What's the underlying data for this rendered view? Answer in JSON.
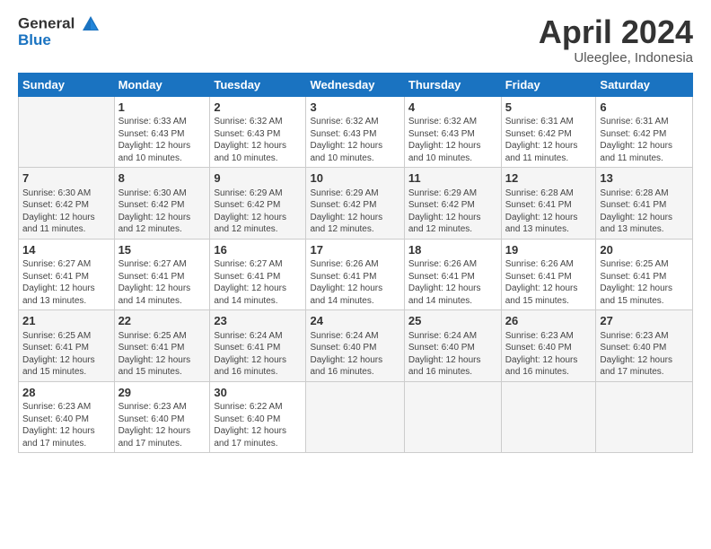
{
  "header": {
    "logo_line1": "General",
    "logo_line2": "Blue",
    "month": "April 2024",
    "location": "Uleeglee, Indonesia"
  },
  "days_of_week": [
    "Sunday",
    "Monday",
    "Tuesday",
    "Wednesday",
    "Thursday",
    "Friday",
    "Saturday"
  ],
  "weeks": [
    [
      {
        "day": "",
        "info": ""
      },
      {
        "day": "1",
        "info": "Sunrise: 6:33 AM\nSunset: 6:43 PM\nDaylight: 12 hours\nand 10 minutes."
      },
      {
        "day": "2",
        "info": "Sunrise: 6:32 AM\nSunset: 6:43 PM\nDaylight: 12 hours\nand 10 minutes."
      },
      {
        "day": "3",
        "info": "Sunrise: 6:32 AM\nSunset: 6:43 PM\nDaylight: 12 hours\nand 10 minutes."
      },
      {
        "day": "4",
        "info": "Sunrise: 6:32 AM\nSunset: 6:43 PM\nDaylight: 12 hours\nand 10 minutes."
      },
      {
        "day": "5",
        "info": "Sunrise: 6:31 AM\nSunset: 6:42 PM\nDaylight: 12 hours\nand 11 minutes."
      },
      {
        "day": "6",
        "info": "Sunrise: 6:31 AM\nSunset: 6:42 PM\nDaylight: 12 hours\nand 11 minutes."
      }
    ],
    [
      {
        "day": "7",
        "info": "Sunrise: 6:30 AM\nSunset: 6:42 PM\nDaylight: 12 hours\nand 11 minutes."
      },
      {
        "day": "8",
        "info": "Sunrise: 6:30 AM\nSunset: 6:42 PM\nDaylight: 12 hours\nand 12 minutes."
      },
      {
        "day": "9",
        "info": "Sunrise: 6:29 AM\nSunset: 6:42 PM\nDaylight: 12 hours\nand 12 minutes."
      },
      {
        "day": "10",
        "info": "Sunrise: 6:29 AM\nSunset: 6:42 PM\nDaylight: 12 hours\nand 12 minutes."
      },
      {
        "day": "11",
        "info": "Sunrise: 6:29 AM\nSunset: 6:42 PM\nDaylight: 12 hours\nand 12 minutes."
      },
      {
        "day": "12",
        "info": "Sunrise: 6:28 AM\nSunset: 6:41 PM\nDaylight: 12 hours\nand 13 minutes."
      },
      {
        "day": "13",
        "info": "Sunrise: 6:28 AM\nSunset: 6:41 PM\nDaylight: 12 hours\nand 13 minutes."
      }
    ],
    [
      {
        "day": "14",
        "info": "Sunrise: 6:27 AM\nSunset: 6:41 PM\nDaylight: 12 hours\nand 13 minutes."
      },
      {
        "day": "15",
        "info": "Sunrise: 6:27 AM\nSunset: 6:41 PM\nDaylight: 12 hours\nand 14 minutes."
      },
      {
        "day": "16",
        "info": "Sunrise: 6:27 AM\nSunset: 6:41 PM\nDaylight: 12 hours\nand 14 minutes."
      },
      {
        "day": "17",
        "info": "Sunrise: 6:26 AM\nSunset: 6:41 PM\nDaylight: 12 hours\nand 14 minutes."
      },
      {
        "day": "18",
        "info": "Sunrise: 6:26 AM\nSunset: 6:41 PM\nDaylight: 12 hours\nand 14 minutes."
      },
      {
        "day": "19",
        "info": "Sunrise: 6:26 AM\nSunset: 6:41 PM\nDaylight: 12 hours\nand 15 minutes."
      },
      {
        "day": "20",
        "info": "Sunrise: 6:25 AM\nSunset: 6:41 PM\nDaylight: 12 hours\nand 15 minutes."
      }
    ],
    [
      {
        "day": "21",
        "info": "Sunrise: 6:25 AM\nSunset: 6:41 PM\nDaylight: 12 hours\nand 15 minutes."
      },
      {
        "day": "22",
        "info": "Sunrise: 6:25 AM\nSunset: 6:41 PM\nDaylight: 12 hours\nand 15 minutes."
      },
      {
        "day": "23",
        "info": "Sunrise: 6:24 AM\nSunset: 6:41 PM\nDaylight: 12 hours\nand 16 minutes."
      },
      {
        "day": "24",
        "info": "Sunrise: 6:24 AM\nSunset: 6:40 PM\nDaylight: 12 hours\nand 16 minutes."
      },
      {
        "day": "25",
        "info": "Sunrise: 6:24 AM\nSunset: 6:40 PM\nDaylight: 12 hours\nand 16 minutes."
      },
      {
        "day": "26",
        "info": "Sunrise: 6:23 AM\nSunset: 6:40 PM\nDaylight: 12 hours\nand 16 minutes."
      },
      {
        "day": "27",
        "info": "Sunrise: 6:23 AM\nSunset: 6:40 PM\nDaylight: 12 hours\nand 17 minutes."
      }
    ],
    [
      {
        "day": "28",
        "info": "Sunrise: 6:23 AM\nSunset: 6:40 PM\nDaylight: 12 hours\nand 17 minutes."
      },
      {
        "day": "29",
        "info": "Sunrise: 6:23 AM\nSunset: 6:40 PM\nDaylight: 12 hours\nand 17 minutes."
      },
      {
        "day": "30",
        "info": "Sunrise: 6:22 AM\nSunset: 6:40 PM\nDaylight: 12 hours\nand 17 minutes."
      },
      {
        "day": "",
        "info": ""
      },
      {
        "day": "",
        "info": ""
      },
      {
        "day": "",
        "info": ""
      },
      {
        "day": "",
        "info": ""
      }
    ]
  ]
}
